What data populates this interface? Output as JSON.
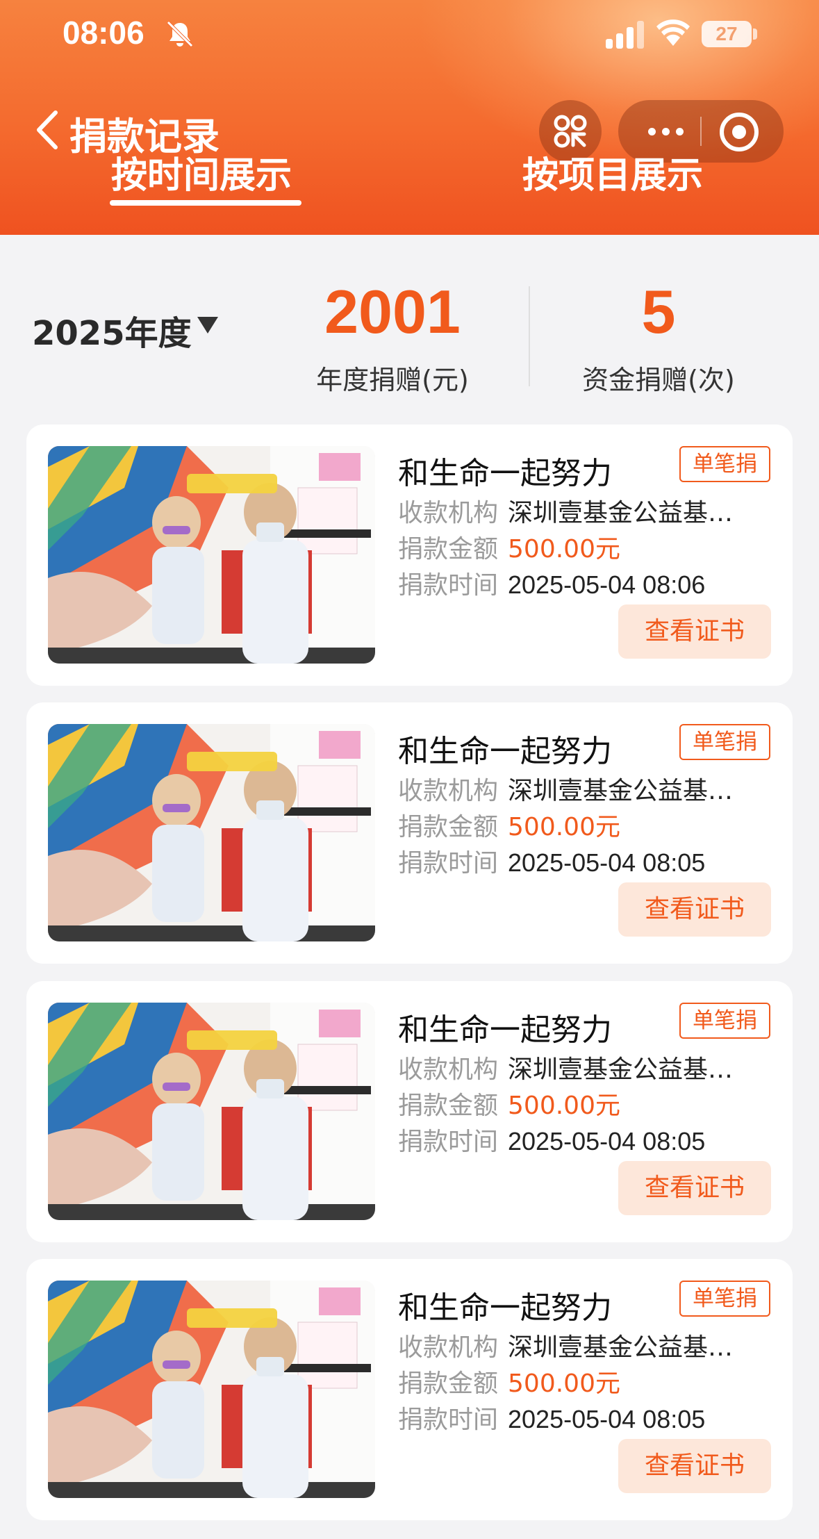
{
  "status_bar": {
    "time": "08:06",
    "battery": "27"
  },
  "header": {
    "title": "捐款记录"
  },
  "tabs": [
    {
      "label": "按时间展示",
      "active": true
    },
    {
      "label": "按项目展示",
      "active": false
    }
  ],
  "summary": {
    "year": "2025年度",
    "annual_amount": "2001",
    "annual_amount_label": "年度捐赠(元)",
    "count": "5",
    "count_label": "资金捐赠(次)"
  },
  "labels": {
    "org": "收款机构",
    "amount": "捐款金额",
    "time": "捐款时间",
    "cert_button": "查看证书"
  },
  "donations": [
    {
      "title": "和生命一起努力",
      "badge": "单笔捐",
      "org": "深圳壹基金公益基…",
      "amount": "500.00元",
      "time": "2025-05-04 08:06"
    },
    {
      "title": "和生命一起努力",
      "badge": "单笔捐",
      "org": "深圳壹基金公益基…",
      "amount": "500.00元",
      "time": "2025-05-04 08:05"
    },
    {
      "title": "和生命一起努力",
      "badge": "单笔捐",
      "org": "深圳壹基金公益基…",
      "amount": "500.00元",
      "time": "2025-05-04 08:05"
    },
    {
      "title": "和生命一起努力",
      "badge": "单笔捐",
      "org": "深圳壹基金公益基…",
      "amount": "500.00元",
      "time": "2025-05-04 08:05"
    }
  ],
  "colors": {
    "accent": "#f15a1c",
    "header_top": "#f6823f",
    "header_bottom": "#ef5220"
  },
  "icons": [
    "bell-off-icon",
    "signal-icon",
    "wifi-icon",
    "battery-icon",
    "back-icon",
    "scan-icon",
    "more-icon",
    "close-mini-program-icon"
  ]
}
